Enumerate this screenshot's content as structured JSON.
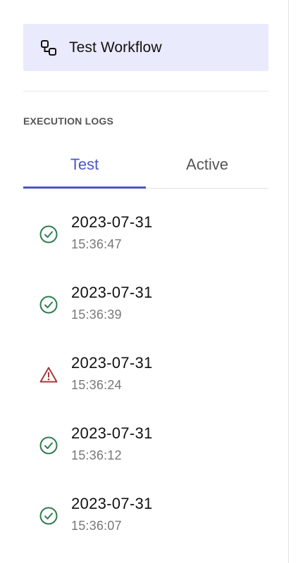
{
  "workflow": {
    "title": "Test Workflow",
    "icon": "workflow-nodes-icon"
  },
  "section": {
    "title": "EXECUTION LOGS"
  },
  "tabs": [
    {
      "label": "Test",
      "active": true
    },
    {
      "label": "Active",
      "active": false
    }
  ],
  "logs": [
    {
      "date": "2023-07-31",
      "time": "15:36:47",
      "status": "success",
      "icon": "check-circle-icon"
    },
    {
      "date": "2023-07-31",
      "time": "15:36:39",
      "status": "success",
      "icon": "check-circle-icon"
    },
    {
      "date": "2023-07-31",
      "time": "15:36:24",
      "status": "error",
      "icon": "warning-triangle-icon"
    },
    {
      "date": "2023-07-31",
      "time": "15:36:12",
      "status": "success",
      "icon": "check-circle-icon"
    },
    {
      "date": "2023-07-31",
      "time": "15:36:07",
      "status": "success",
      "icon": "check-circle-icon"
    }
  ],
  "colors": {
    "accent": "#4c55c7",
    "card_background": "#e9eafc",
    "success": "#2e7d4f",
    "error": "#a33a3a"
  }
}
